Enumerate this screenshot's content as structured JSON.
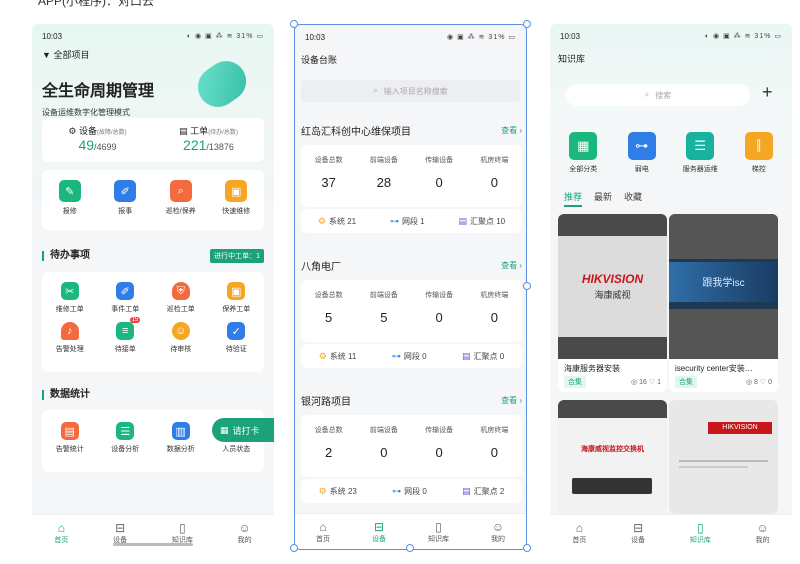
{
  "caption": "APP(小程序)：对口云",
  "status": {
    "time": "10:03",
    "battery": "31%"
  },
  "screen1": {
    "project_selector": "全部项目",
    "title": "全生命周期管理",
    "subtitle": "设备运维数字化管理模式",
    "device": {
      "label": "设备",
      "sub": "(故障/总数)",
      "fault": "49",
      "total": "/4699"
    },
    "order": {
      "label": "工单",
      "sub": "(待办/总数)",
      "todo": "221",
      "total": "/13876"
    },
    "quick": [
      "报修",
      "报事",
      "巡检/保养",
      "快速维修"
    ],
    "todo_title": "待办事项",
    "todo_badge": "进行中工单：1",
    "todo_items": [
      "维修工单",
      "事件工单",
      "巡检工单",
      "保养工单",
      "告警处理",
      "待接单",
      "待审核",
      "待验证"
    ],
    "todo_count": "15",
    "stats_title": "数据统计",
    "stats_items": [
      "告警统计",
      "设备分析",
      "数据分析",
      "人员状态"
    ],
    "punch_button": "请打卡"
  },
  "screen2": {
    "header": "设备台账",
    "search_placeholder": "输入项目名称搜索",
    "stat_labels": [
      "设备总数",
      "前端设备",
      "传输设备",
      "机房终端"
    ],
    "foot_labels": [
      "系统",
      "网段",
      "汇聚点"
    ],
    "view_label": "查看",
    "projects": [
      {
        "name": "红岛汇科创中心维保项目",
        "values": [
          "37",
          "28",
          "0",
          "0"
        ],
        "foot": [
          "21",
          "1",
          "10"
        ]
      },
      {
        "name": "八角电厂",
        "values": [
          "5",
          "5",
          "0",
          "0"
        ],
        "foot": [
          "11",
          "0",
          "0"
        ]
      },
      {
        "name": "银河路项目",
        "values": [
          "2",
          "0",
          "0",
          "0"
        ],
        "foot": [
          "23",
          "0",
          "2"
        ]
      }
    ]
  },
  "screen3": {
    "header": "知识库",
    "search_placeholder": "搜索",
    "categories": [
      "全部分类",
      "弱电",
      "服务器运维",
      "梯控"
    ],
    "tabs": [
      "推荐",
      "最新",
      "收藏"
    ],
    "articles": [
      {
        "title": "海康服务器安装",
        "tag": "合集",
        "views": "16",
        "likes": "1",
        "brand": "HIKVISION",
        "brand_cn": "海康威视"
      },
      {
        "title": "isecurity center安装…",
        "tag": "合集",
        "views": "8",
        "likes": "0",
        "brand": "跟我学isc"
      },
      {
        "title": "",
        "brand": "海康威视监控交换机"
      },
      {
        "title": "",
        "brand": "HIKVISION"
      }
    ]
  },
  "tabbar": [
    "首页",
    "设备",
    "知识库",
    "我的"
  ],
  "colors": {
    "accent": "#1aa37a",
    "selection": "#5b8fe6"
  }
}
